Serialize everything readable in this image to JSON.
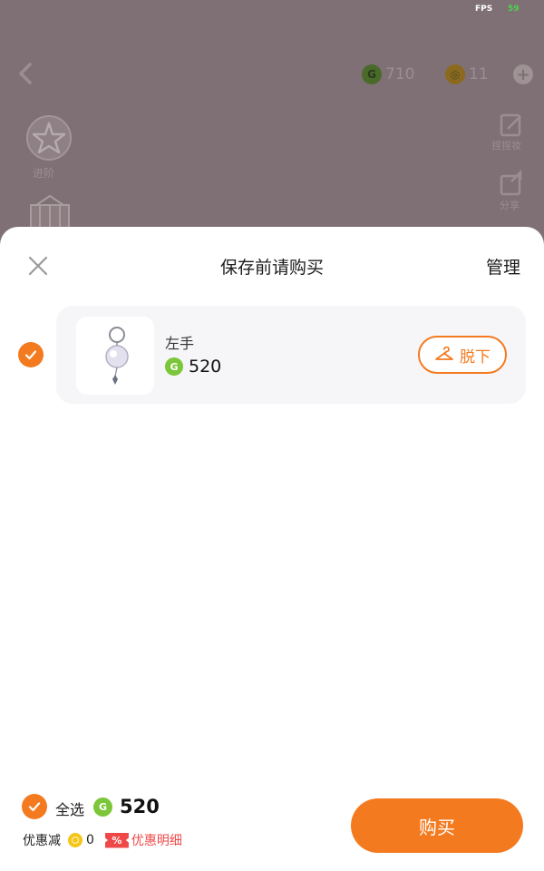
{
  "status": {
    "fps_label": "FPS",
    "fps_value": "59"
  },
  "background": {
    "currency_green": "710",
    "currency_gold": "11",
    "star_label": "进阶",
    "side_label_1": "捏捏妆",
    "side_label_2": "分享"
  },
  "sheet": {
    "title": "保存前请购买",
    "manage_label": "管理",
    "items": [
      {
        "name": "左手",
        "price": "520",
        "takeoff_label": "脱下",
        "checked": true
      }
    ]
  },
  "footer": {
    "select_all_label": "全选",
    "total": "520",
    "discount_label": "优惠减",
    "discount_value": "0",
    "discount_badge": "%",
    "discount_detail_label": "优惠明细",
    "buy_label": "购买"
  },
  "colors": {
    "accent": "#f47a1f",
    "green_coin": "#7cc63a",
    "gold_coin": "#f5c51a",
    "discount_red": "#ef4848",
    "overlay": "#7e7074"
  },
  "icons": {
    "close": "close-icon",
    "check": "check-icon",
    "hanger": "hanger-icon",
    "g_coin": "g-coin-icon",
    "gold_coin": "gold-coin-icon",
    "back": "back-arrow-icon"
  }
}
